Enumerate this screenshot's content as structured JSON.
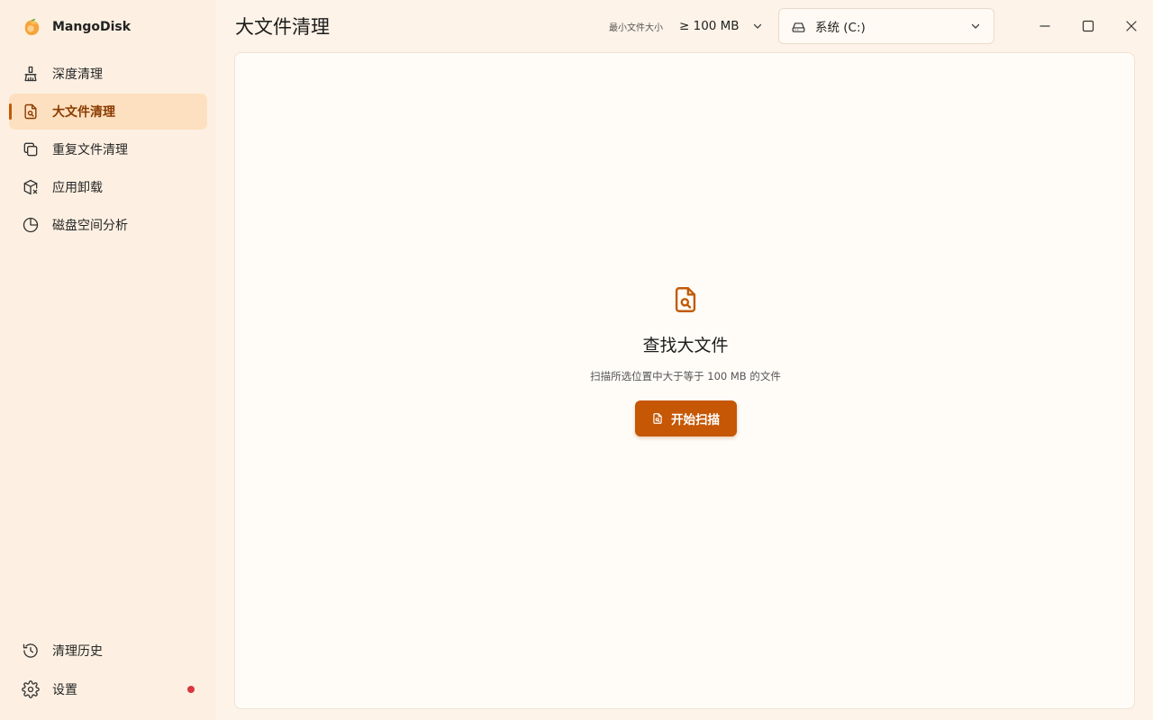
{
  "app": {
    "name": "MangoDisk"
  },
  "sidebar": {
    "items": [
      {
        "label": "深度清理",
        "icon": "broom-icon",
        "active": false
      },
      {
        "label": "大文件清理",
        "icon": "file-search-icon",
        "active": true
      },
      {
        "label": "重复文件清理",
        "icon": "copy-icon",
        "active": false
      },
      {
        "label": "应用卸载",
        "icon": "package-remove-icon",
        "active": false
      },
      {
        "label": "磁盘空间分析",
        "icon": "pie-chart-icon",
        "active": false
      }
    ],
    "bottom": [
      {
        "label": "清理历史",
        "icon": "history-icon"
      },
      {
        "label": "设置",
        "icon": "gear-icon",
        "badge": true
      }
    ]
  },
  "header": {
    "title": "大文件清理",
    "min_size_label": "最小文件大小",
    "min_size_value": "≥ 100 MB",
    "drive": "系统 (C:)"
  },
  "empty_state": {
    "title": "查找大文件",
    "subtitle": "扫描所选位置中大于等于 100 MB 的文件",
    "button": "开始扫描"
  },
  "colors": {
    "accent": "#c55705",
    "active_bg": "#fde0bf",
    "active_text": "#8a3b00",
    "badge": "#d9363e"
  }
}
